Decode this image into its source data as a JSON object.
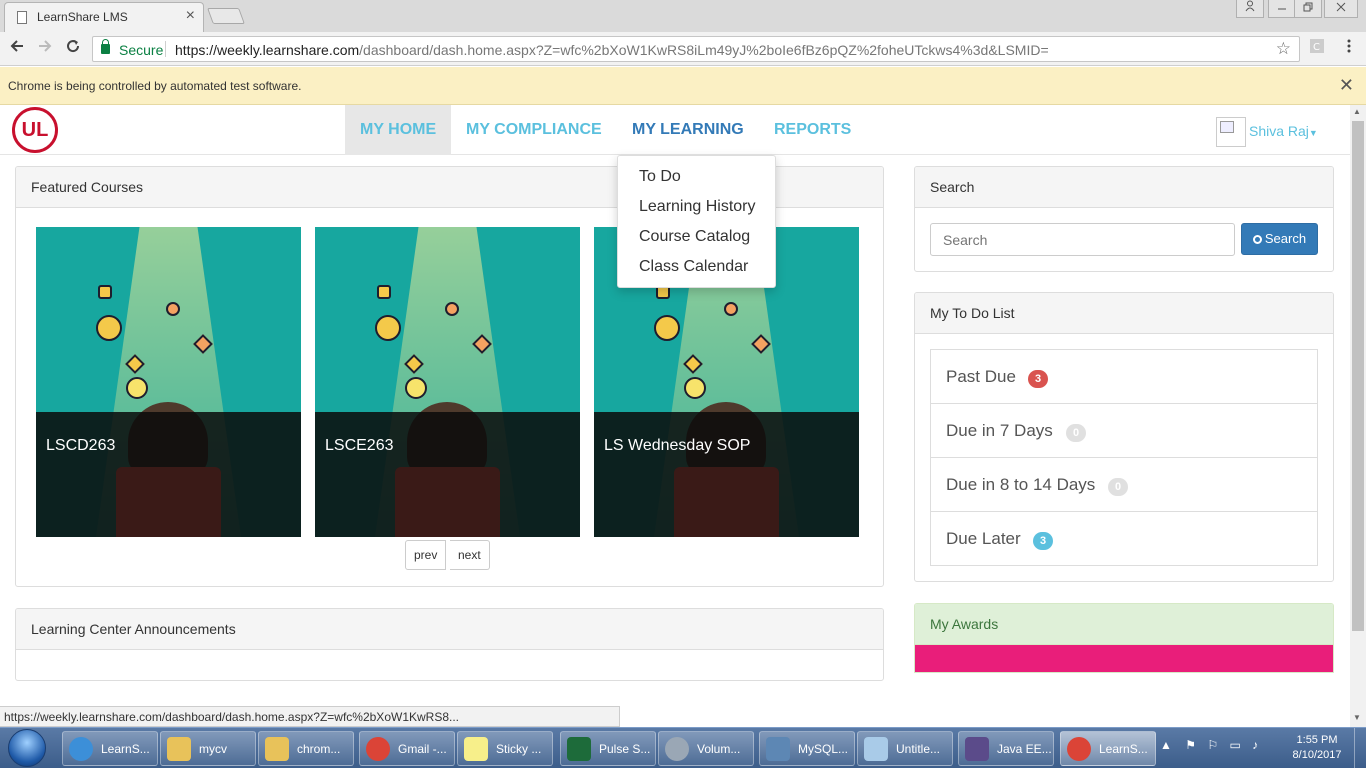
{
  "browser": {
    "tab_title": "LearnShare LMS",
    "tab_close": "×",
    "secure_label": "Secure",
    "url_host": "https://weekly.learnshare.com",
    "url_path": "/dashboard/dash.home.aspx?Z=wfc%2bXoW1KwRS8iLm49yJ%2boIe6fBz6pQZ%2foheUTckws4%3d&LSMID=",
    "infobar_message": "Chrome is being controlled by automated test software.",
    "status_url": "https://weekly.learnshare.com/dashboard/dash.home.aspx?Z=wfc%2bXoW1KwRS8..."
  },
  "app": {
    "logo_text": "UL",
    "nav": [
      {
        "label": "MY HOME"
      },
      {
        "label": "MY COMPLIANCE"
      },
      {
        "label": "MY LEARNING"
      },
      {
        "label": "REPORTS"
      }
    ],
    "user_name": "Shiva Raj",
    "learning_menu": [
      "To Do",
      "Learning History",
      "Course Catalog",
      "Class Calendar"
    ]
  },
  "featured": {
    "heading": "Featured Courses",
    "courses": [
      {
        "title": "LSCD263"
      },
      {
        "title": "LSCE263"
      },
      {
        "title": "LS Wednesday SOP"
      }
    ],
    "prev_label": "prev",
    "next_label": "next"
  },
  "announcements": {
    "heading": "Learning Center Announcements"
  },
  "search": {
    "heading": "Search",
    "placeholder": "Search",
    "button_label": "Search"
  },
  "todo": {
    "heading": "My To Do List",
    "items": [
      {
        "label": "Past Due",
        "count": "3",
        "color": "#d9534f"
      },
      {
        "label": "Due in 7 Days",
        "count": "0",
        "color": "#e0e0e0"
      },
      {
        "label": "Due in 8 to 14 Days",
        "count": "0",
        "color": "#e0e0e0"
      },
      {
        "label": "Due Later",
        "count": "3",
        "color": "#5bc0de"
      }
    ]
  },
  "awards": {
    "heading": "My Awards",
    "bar_color": "#e91e7a"
  },
  "taskbar": {
    "items": [
      {
        "label": "LearnS...",
        "icon": "ie-icon"
      },
      {
        "label": "mycv",
        "icon": "folder-icon"
      },
      {
        "label": "chrom...",
        "icon": "folder-icon"
      },
      {
        "label": "Gmail -...",
        "icon": "chrome-icon"
      },
      {
        "label": "Sticky ...",
        "icon": "sticky-notes-icon"
      },
      {
        "label": "Pulse S...",
        "icon": "pulse-icon"
      },
      {
        "label": "Volum...",
        "icon": "speaker-icon"
      },
      {
        "label": "MySQL...",
        "icon": "mysql-workbench-icon"
      },
      {
        "label": "Untitle...",
        "icon": "notepad-icon"
      },
      {
        "label": "Java EE...",
        "icon": "eclipse-icon"
      },
      {
        "label": "LearnS...",
        "icon": "chrome-icon"
      }
    ],
    "time": "1:55 PM",
    "date": "8/10/2017"
  }
}
